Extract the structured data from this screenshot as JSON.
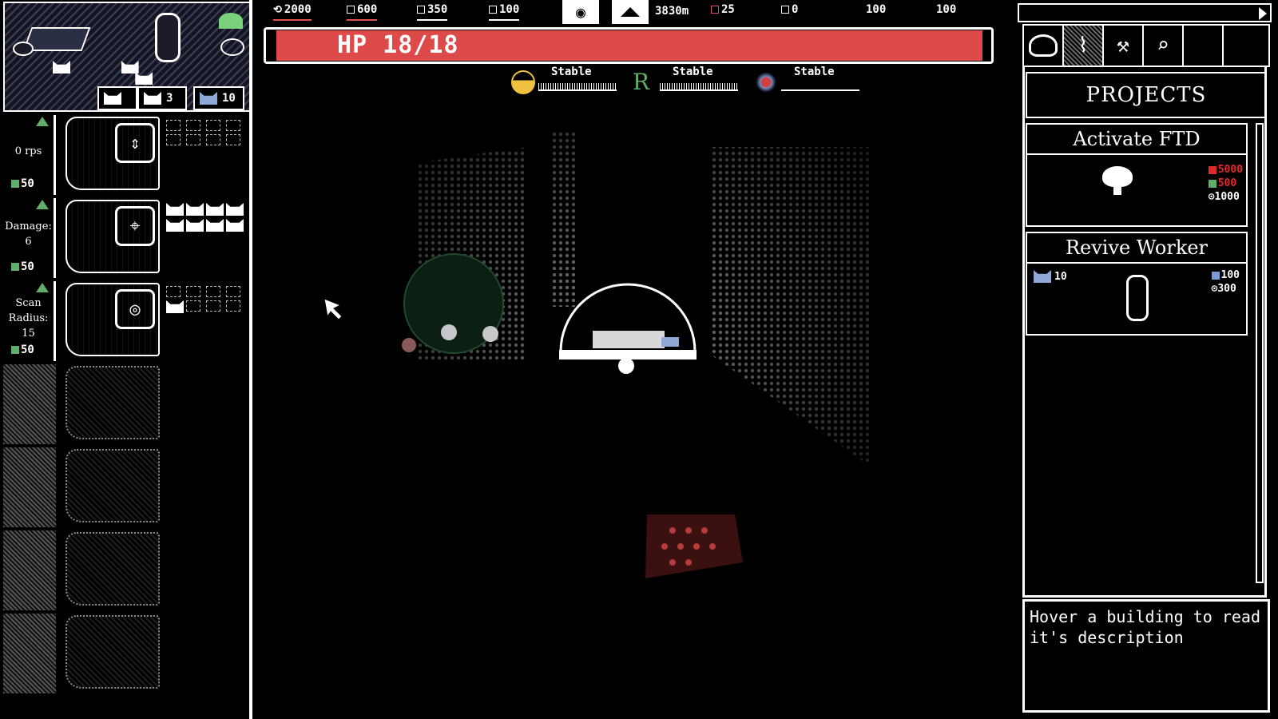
{
  "resources": [
    {
      "icon": "iron-icon",
      "value": "2000",
      "color": "#e05050"
    },
    {
      "icon": "water-icon",
      "value": "600",
      "color": "#e05050"
    },
    {
      "icon": "cobalt-icon",
      "value": "350",
      "color": "#ffffff"
    },
    {
      "icon": "green-ore-icon",
      "value": "100",
      "color": "#ffffff"
    }
  ],
  "depth": "3830m",
  "counters": [
    {
      "icon": "red-ore-icon",
      "value": "25"
    },
    {
      "icon": "plus-icon",
      "value": "0"
    },
    {
      "icon": "none",
      "value": "100"
    },
    {
      "icon": "none",
      "value": "100"
    }
  ],
  "hp": {
    "label": "HP 18/18",
    "current": 18,
    "max": 18
  },
  "gauges": [
    {
      "icon": "oxygen-icon",
      "label": "Stable"
    },
    {
      "icon": "r-icon",
      "label": "Stable"
    },
    {
      "icon": "spore-icon",
      "label": "Stable"
    }
  ],
  "workers": {
    "available": "3",
    "total": "10"
  },
  "stations": [
    {
      "stat": "0 rps",
      "cost": "50",
      "icon": "arrows-icon",
      "filled": 0,
      "slots": 8
    },
    {
      "stat": "Damage:\n6",
      "cost": "50",
      "icon": "target-icon",
      "filled": 8,
      "slots": 8
    },
    {
      "stat": "Scan\nRadius:\n15",
      "cost": "50",
      "icon": "radar-icon",
      "filled": 1,
      "slots": 8
    }
  ],
  "locked_stations": 4,
  "sidebar": {
    "tabs": [
      "dome-icon",
      "map-icon",
      "hammer-icon",
      "magnifier-icon"
    ],
    "title": "PROJECTS",
    "projects": [
      {
        "title": "Activate FTD",
        "icon": "ftd-icon",
        "costs": [
          {
            "icon": "iron-icon",
            "value": "5000",
            "color": "#e02a2a"
          },
          {
            "icon": "green-ore-icon",
            "value": "500",
            "color": "#e02a2a"
          },
          {
            "icon": "time-icon",
            "value": "1000",
            "color": "#ffffff"
          }
        ]
      },
      {
        "title": "Revive Worker",
        "icon": "capsule-icon",
        "workers": "10",
        "costs": [
          {
            "icon": "cobalt-icon",
            "value": "100",
            "color": "#ffffff"
          },
          {
            "icon": "time-icon",
            "value": "300",
            "color": "#ffffff"
          }
        ]
      }
    ],
    "description": "Hover a building to read it's description"
  }
}
